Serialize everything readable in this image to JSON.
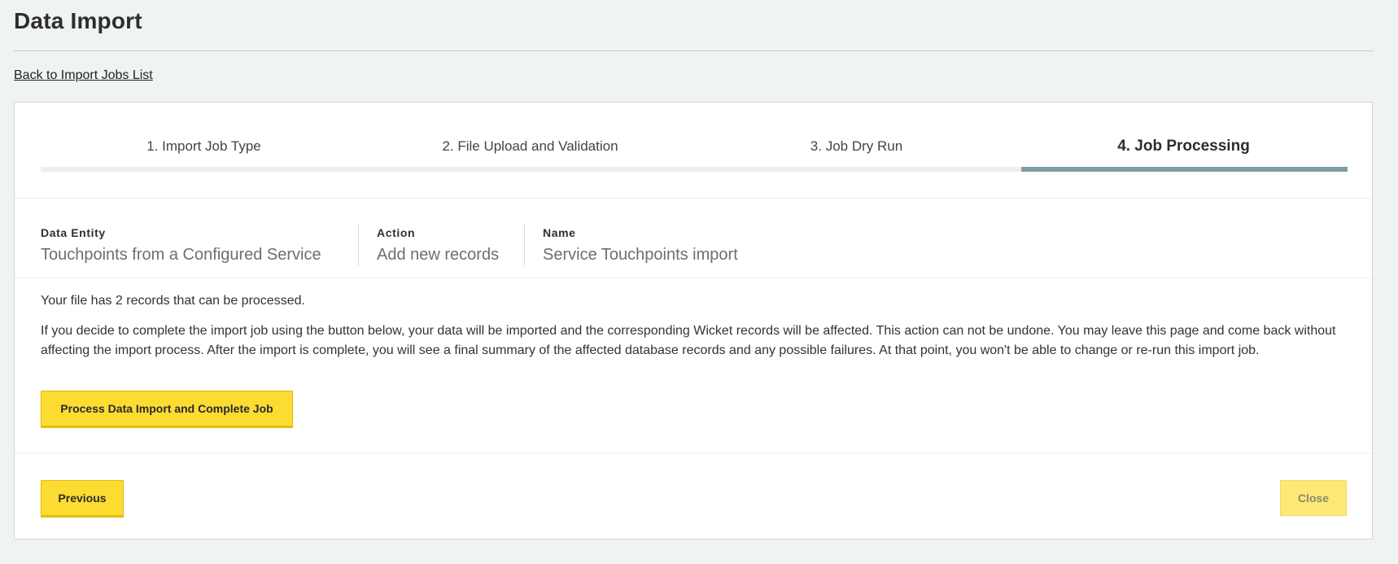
{
  "page": {
    "title": "Data Import"
  },
  "back_link": {
    "label": "Back to Import Jobs List"
  },
  "steps": [
    {
      "label": "1. Import Job Type",
      "active": false
    },
    {
      "label": "2. File Upload and Validation",
      "active": false
    },
    {
      "label": "3. Job Dry Run",
      "active": false
    },
    {
      "label": "4. Job Processing",
      "active": true
    }
  ],
  "progress": {
    "current_step": 4,
    "total_steps": 4
  },
  "meta": {
    "data_entity": {
      "label": "Data Entity",
      "value": "Touchpoints from a Configured Service"
    },
    "action": {
      "label": "Action",
      "value": "Add new records"
    },
    "name": {
      "label": "Name",
      "value": "Service Touchpoints import"
    }
  },
  "body": {
    "records_text": "Your file has 2 records that can be processed.",
    "warning_text": "If you decide to complete the import job using the button below, your data will be imported and the corresponding Wicket records will be affected. This action can not be undone. You may leave this page and come back without affecting the import process. After the import is complete, you will see a final summary of the affected database records and any possible failures. At that point, you won't be able to change or re-run this import job."
  },
  "buttons": {
    "process_label": "Process Data Import and Complete Job",
    "previous_label": "Previous",
    "close_label": "Close"
  },
  "colors": {
    "accent_yellow": "#fddc32",
    "step_active": "#7f9ea1",
    "background": "#f0f3f3"
  }
}
